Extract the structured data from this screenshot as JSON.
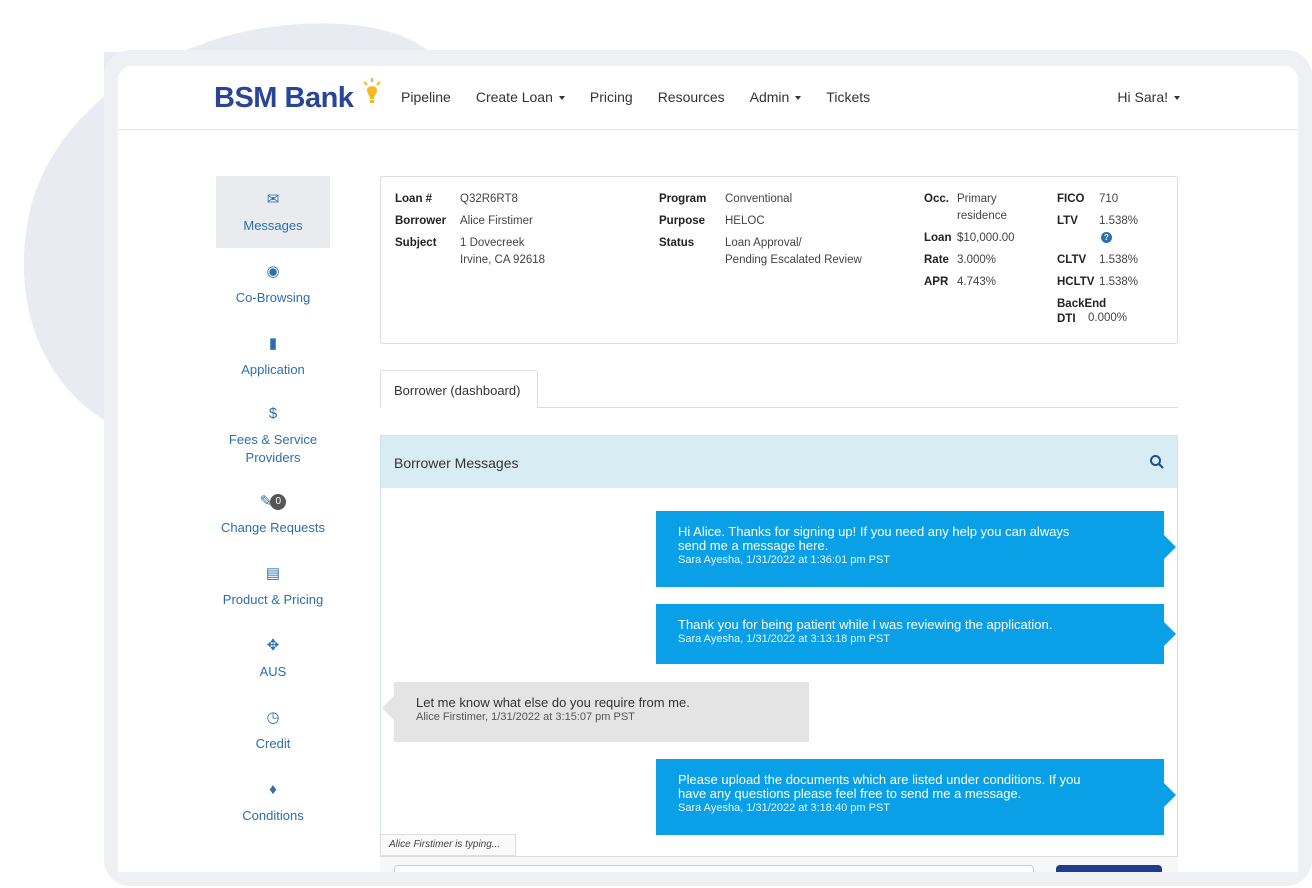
{
  "nav": {
    "logo": "BSM Bank",
    "items": [
      "Pipeline",
      "Create Loan",
      "Pricing",
      "Resources",
      "Admin",
      "Tickets"
    ],
    "user": "Hi Sara!"
  },
  "sidebar": {
    "items": [
      {
        "label": "Messages",
        "icon": "envelope-icon"
      },
      {
        "label": "Co-Browsing",
        "icon": "eye-icon"
      },
      {
        "label": "Application",
        "icon": "document-icon"
      },
      {
        "label": "Fees & Service Providers",
        "icon": "dollar-icon"
      },
      {
        "label": "Change Requests",
        "icon": "pencil-icon",
        "badge": "0"
      },
      {
        "label": "Product & Pricing",
        "icon": "list-icon"
      },
      {
        "label": "AUS",
        "icon": "crosshair-icon"
      },
      {
        "label": "Credit",
        "icon": "gauge-icon"
      },
      {
        "label": "Conditions",
        "icon": "bell-icon"
      }
    ]
  },
  "summary": {
    "loan_num_label": "Loan #",
    "loan_num": "Q32R6RT8",
    "borrower_label": "Borrower",
    "borrower": "Alice Firstimer",
    "subject_label": "Subject",
    "subject_line1": "1 Dovecreek",
    "subject_line2": "Irvine, CA 92618",
    "program_label": "Program",
    "program": "Conventional",
    "purpose_label": "Purpose",
    "purpose": "HELOC",
    "status_label": "Status",
    "status_line1": "Loan Approval/",
    "status_line2": "Pending Escalated Review",
    "occ_label": "Occ.",
    "occ_line1": "Primary",
    "occ_line2": "residence",
    "loan_label": "Loan",
    "loan": "$10,000.00",
    "rate_label": "Rate",
    "rate": "3.000%",
    "apr_label": "APR",
    "apr": "4.743%",
    "fico_label": "FICO",
    "fico": "710",
    "ltv_label": "LTV",
    "ltv": "1.538%",
    "cltv_label": "CLTV",
    "cltv": "1.538%",
    "hcltv_label": "HCLTV",
    "hcltv": "1.538%",
    "backend_label1": "BackEnd",
    "backend_label2": "DTI",
    "backend": "0.000%"
  },
  "tabs": [
    "Borrower (dashboard)"
  ],
  "messages": {
    "title": "Borrower Messages",
    "list": [
      {
        "dir": "out",
        "line1": "Hi Alice. Thanks for signing up! If you need any help you can always",
        "line2": "send me a message here.",
        "meta": "Sara Ayesha, 1/31/2022 at 1:36:01 pm PST"
      },
      {
        "dir": "out",
        "line1": "Thank you for being patient while I was reviewing the application.",
        "meta": "Sara Ayesha, 1/31/2022 at 3:13:18 pm PST"
      },
      {
        "dir": "in",
        "line1": "Let me know what else do you require from me.",
        "meta": "Alice Firstimer, 1/31/2022 at 3:15:07 pm PST"
      },
      {
        "dir": "out",
        "line1": "Please upload the documents which are listed under conditions. If you",
        "line2": "have any questions please feel free to send me a message.",
        "meta": "Sara Ayesha, 1/31/2022 at 3:18:40 pm PST"
      }
    ],
    "typing": "Alice Firstimer is typing..."
  },
  "colors": {
    "brand": "#2a4597",
    "accent": "#0aa0e8",
    "link": "#2a6fb0",
    "panel_head": "#d8edf3"
  }
}
